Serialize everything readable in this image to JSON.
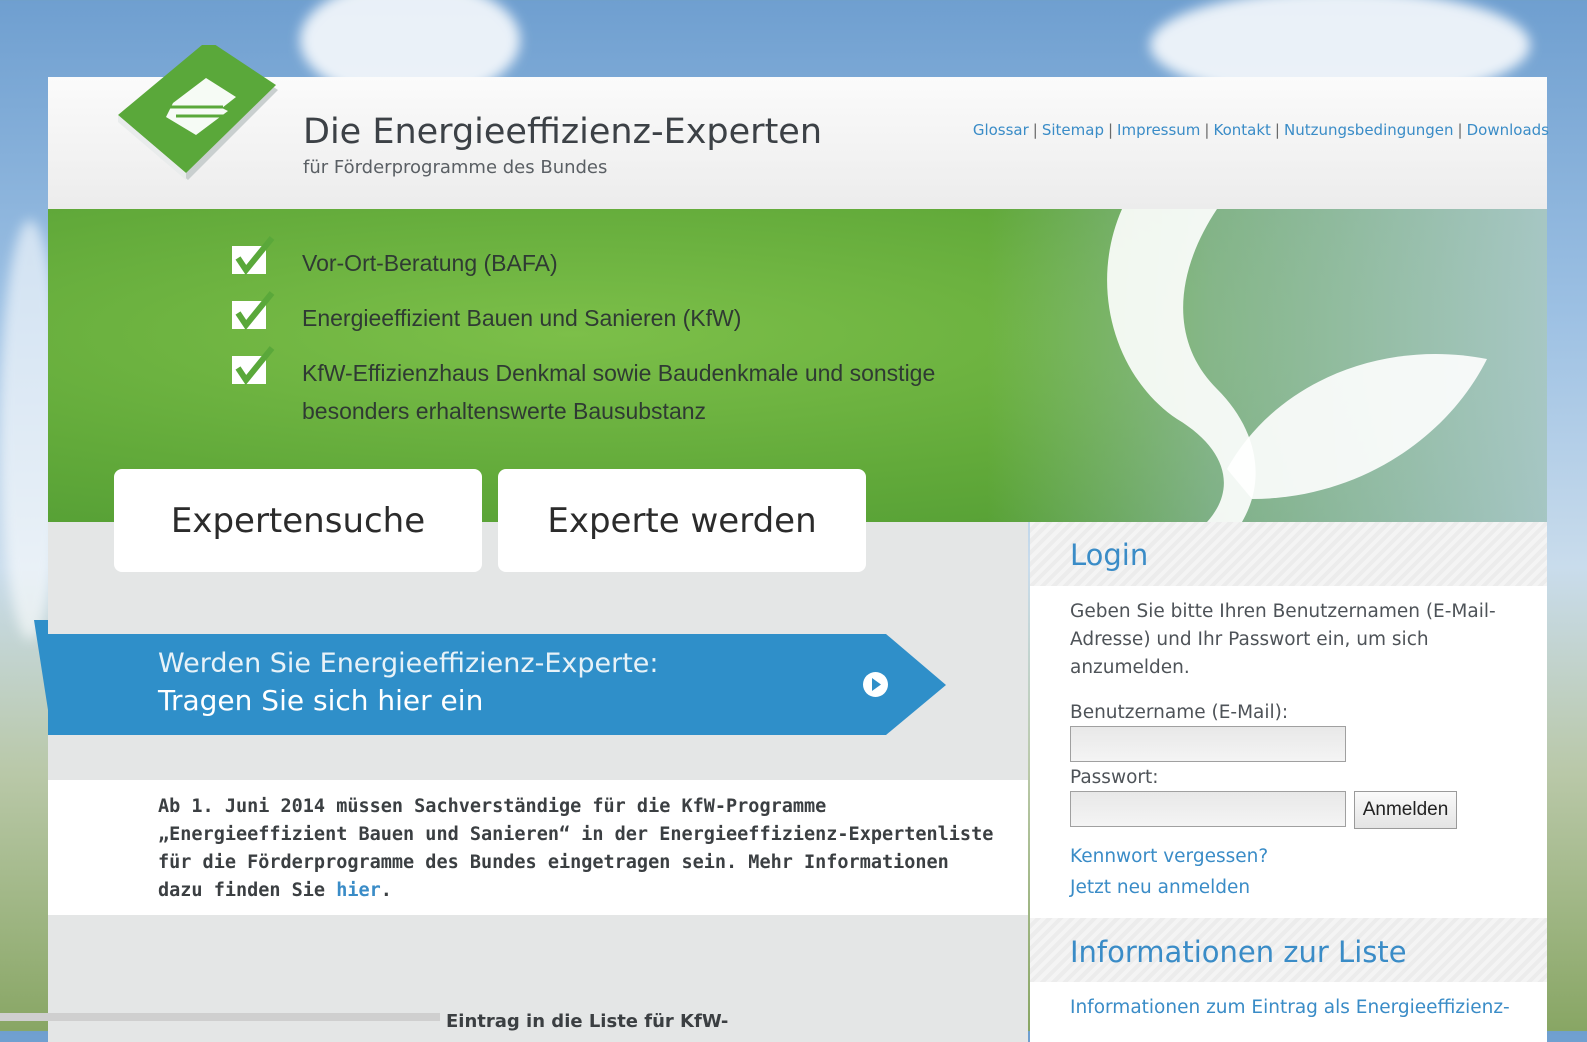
{
  "header": {
    "title": "Die Energieeffizienz-Experten",
    "subtitle": "für Förderprogramme des Bundes",
    "nav": [
      "Glossar",
      "Sitemap",
      "Impressum",
      "Kontakt",
      "Nutzungsbedingungen",
      "Downloads"
    ]
  },
  "banner": {
    "items": [
      "Vor-Ort-Beratung (BAFA)",
      "Energieeffizient Bauen und Sanieren (KfW)",
      "KfW-Effizienzhaus Denkmal sowie Baudenkmale und sonstige",
      "besonders erhaltenswerte Bausubstanz"
    ]
  },
  "tabs": {
    "search": "Expertensuche",
    "become": "Experte werden"
  },
  "cta": {
    "line1": "Werden Sie Energieeffizienz-Experte:",
    "line2": "Tragen Sie sich hier ein"
  },
  "notice": {
    "text": "Ab 1. Juni 2014 müssen Sachverständige für die KfW-Programme „Energieeffizient Bauen und Sanieren“ in der Energieeffizienz-Expertenliste für die Förderprogramme des Bundes eingetragen sein. Mehr Informationen dazu finden Sie ",
    "link": "hier",
    "end": "."
  },
  "cut_text": "Eintrag in die Liste für KfW-",
  "login": {
    "title": "Login",
    "intro_1": "Geben Sie bitte Ihren Benutzernamen (E-Mail-",
    "intro_2": "Adresse) und Ihr Passwort ein, um sich",
    "intro_3": "anzumelden.",
    "username_label": "Benutzername (E-Mail):",
    "username_value": "",
    "password_label": "Passwort:",
    "password_value": "",
    "submit": "Anmelden",
    "forgot": "Kennwort vergessen?",
    "register": "Jetzt neu anmelden"
  },
  "info": {
    "title": "Informationen zur Liste",
    "link": "Informationen zum Eintrag als Energieeffizienz-"
  },
  "colors": {
    "link": "#3a8cc7",
    "banner_green": "#62aa3a",
    "cta_blue": "#2f8fc9"
  }
}
